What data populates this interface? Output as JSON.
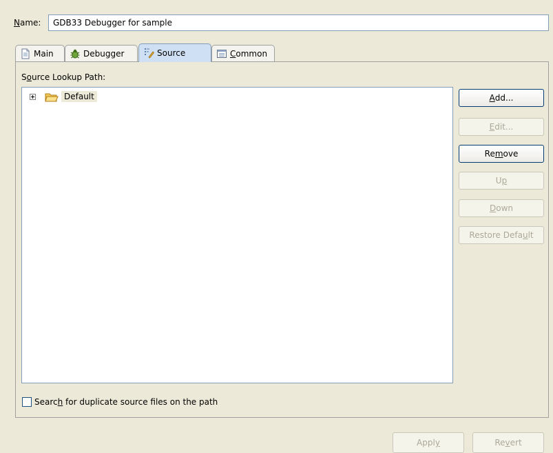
{
  "name_field": {
    "label_prefix": "",
    "label_mnemonic": "N",
    "label_rest": "ame:",
    "value": "GDB33 Debugger for sample"
  },
  "tabs": [
    {
      "label": "Main",
      "mnemonic": "",
      "icon": "main-icon",
      "active": false
    },
    {
      "label": "Debugger",
      "mnemonic": "",
      "icon": "debugger-bug-icon",
      "active": false
    },
    {
      "label": "Source",
      "mnemonic": "",
      "icon": "source-icon",
      "active": true
    },
    {
      "label_mnemonic": "C",
      "label_rest": "ommon",
      "icon": "common-icon",
      "active": false
    }
  ],
  "source_lookup": {
    "label_prefix": "S",
    "label_mnemonic": "o",
    "label_rest": "urce Lookup Path:",
    "tree": [
      {
        "label": "Default",
        "icon": "folder-open-icon",
        "expander": "plus"
      }
    ]
  },
  "buttons": [
    {
      "pre": "",
      "mn": "A",
      "post": "dd...",
      "enabled": true
    },
    {
      "pre": "",
      "mn": "E",
      "post": "dit...",
      "enabled": false
    },
    {
      "pre": "Re",
      "mn": "m",
      "post": "ove",
      "enabled": true
    },
    {
      "pre": "U",
      "mn": "p",
      "post": "",
      "enabled": false
    },
    {
      "pre": "",
      "mn": "D",
      "post": "own",
      "enabled": false
    },
    {
      "pre": "Restore Defa",
      "mn": "u",
      "post": "lt",
      "enabled": false
    }
  ],
  "duplicate_check": {
    "pre": "Searc",
    "mn": "h",
    "post": " for duplicate source files on the path",
    "checked": false
  },
  "footer": {
    "apply": {
      "pre": "Appl",
      "mn": "y",
      "post": ""
    },
    "revert": {
      "pre": "Re",
      "mn": "v",
      "post": "ert"
    }
  }
}
